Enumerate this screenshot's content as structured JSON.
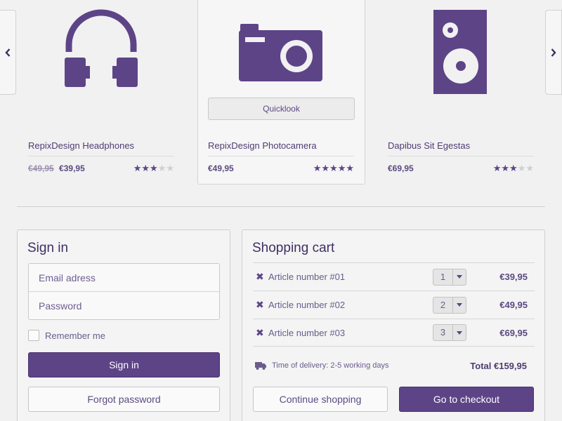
{
  "carousel": {
    "products": [
      {
        "name": "RepixDesign Headphones",
        "old_price": "€49,95",
        "price": "€39,95",
        "rating": 3,
        "max_rating": 5,
        "icon": "headphones-icon"
      },
      {
        "name": "RepixDesign Photocamera",
        "old_price": "",
        "price": "€49,95",
        "rating": 5,
        "max_rating": 5,
        "icon": "camera-icon",
        "quicklook_label": "Quicklook"
      },
      {
        "name": "Dapibus Sit Egestas",
        "old_price": "",
        "price": "€69,95",
        "rating": 3,
        "max_rating": 5,
        "icon": "speaker-icon"
      }
    ]
  },
  "signin": {
    "title": "Sign in",
    "email_placeholder": "Email adress",
    "password_placeholder": "Password",
    "remember_label": "Remember me",
    "signin_label": "Sign in",
    "forgot_label": "Forgot password"
  },
  "cart": {
    "title": "Shopping cart",
    "items": [
      {
        "article": "Article number #01",
        "qty": "1",
        "amount": "€39,95"
      },
      {
        "article": "Article number #02",
        "qty": "2",
        "amount": "€49,95"
      },
      {
        "article": "Article number #03",
        "qty": "3",
        "amount": "€69,95"
      }
    ],
    "delivery": "Time of delivery: 2-5 working days",
    "total": "Total €159,95",
    "continue_label": "Continue shopping",
    "checkout_label": "Go to checkout"
  },
  "colors": {
    "accent": "#5d4487",
    "background": "#f1f1f1",
    "star_off": "#cfcfcf"
  }
}
